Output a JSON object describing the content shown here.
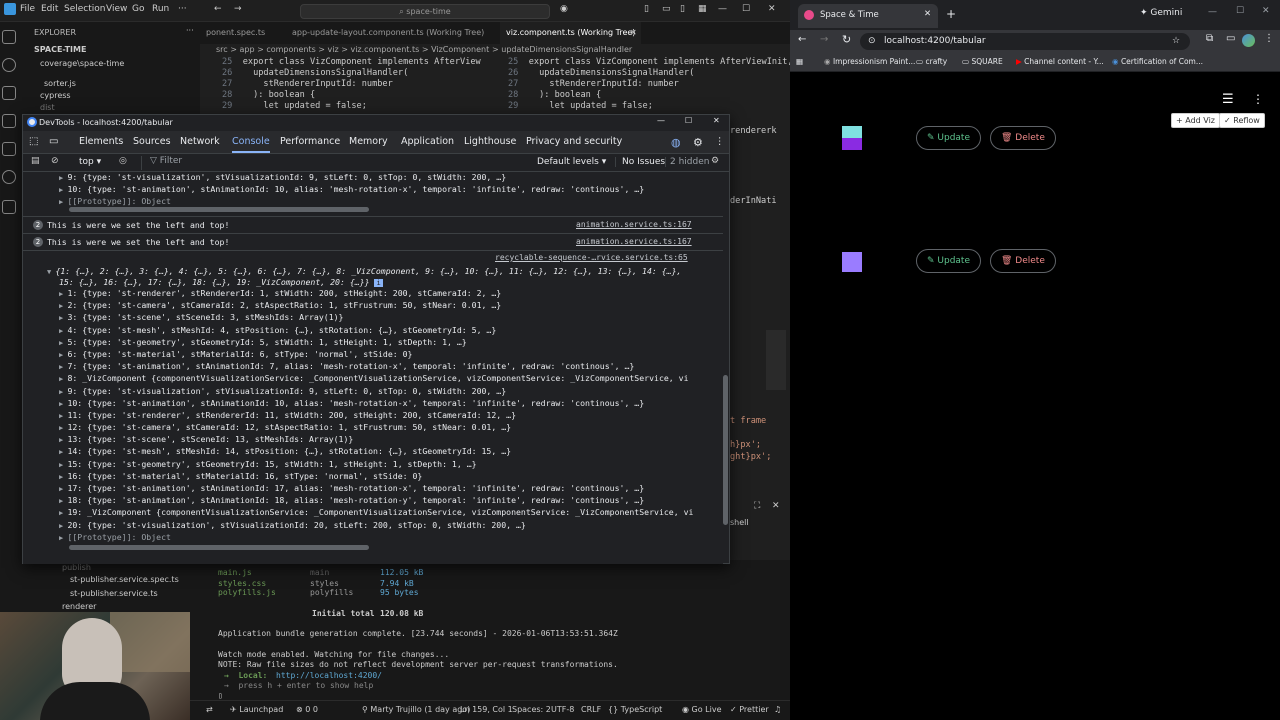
{
  "vscode": {
    "menu": [
      "File",
      "Edit",
      "Selection",
      "View",
      "Go",
      "Run"
    ],
    "search_placeholder": "space-time",
    "explorer": {
      "title": "EXPLORER",
      "project": "SPACE-TIME",
      "items": [
        "coverage\\space-time",
        "sorter.js",
        "cypress",
        "dist"
      ],
      "lower_items": [
        "publish",
        "st-publisher.service.spec.ts",
        "st-publisher.service.ts",
        "renderer"
      ]
    },
    "tabs": [
      {
        "label": "ponent.spec.ts",
        "active": false
      },
      {
        "label": "app-update-layout.component.ts (Working Tree)",
        "active": false
      },
      {
        "label": "viz.component.ts (Working Tree)",
        "active": true
      }
    ],
    "breadcrumb_left": "src > app > components > viz > viz.component.ts > VizComponent",
    "breadcrumb_right": "> updateDimensionsSignalHandler",
    "code_left": [
      {
        "n": "25",
        "text": "export class VizComponent implements AfterView"
      },
      {
        "n": "26",
        "text": "  updateDimensionsSignalHandler("
      },
      {
        "n": "27",
        "text": "    stRendererInputId: number"
      },
      {
        "n": "28",
        "text": "  ): boolean {"
      },
      {
        "n": "29",
        "text": "    let updated = false;"
      }
    ],
    "code_right": [
      {
        "n": "25",
        "text": "export class VizComponent implements AfterViewInit,"
      },
      {
        "n": "26",
        "text": "  updateDimensionsSignalHandler("
      },
      {
        "n": "27",
        "text": "    stRendererInputId: number"
      },
      {
        "n": "28",
        "text": "  ): boolean {"
      },
      {
        "n": "29",
        "text": "    let updated = false;"
      }
    ],
    "right_peek": [
      "rendererk",
      "derInNati",
      "t frame",
      "h}px';",
      "ght}px';"
    ],
    "terminal": {
      "rows": [
        {
          "file": "main.js",
          "name": "main",
          "size": "112.05 kB"
        },
        {
          "file": "styles.css",
          "name": "styles",
          "size": "7.94 kB"
        },
        {
          "file": "polyfills.js",
          "name": "polyfills",
          "size": "95 bytes"
        }
      ],
      "total_label": "Initial total",
      "total_size": "120.08 kB",
      "line1": "Application bundle generation complete. [23.744 seconds] - 2026-01-06T13:53:51.364Z",
      "line2": "Watch mode enabled. Watching for file changes...",
      "line3": "NOTE: Raw file sizes do not reflect development server per-request transformations.",
      "local_label": "→  Local:",
      "local_url": "http://localhost:4200/",
      "help": "→  press h + enter to show help",
      "shell": "shell"
    },
    "status": {
      "launchpad": "Launchpad",
      "problems": "0  0",
      "blame": "Marty Trujillo (1 day ago)",
      "position": "Ln 159, Col 1",
      "spaces": "Spaces: 2",
      "encoding": "UTF-8",
      "eol": "CRLF",
      "language": "TypeScript",
      "golive": "Go Live",
      "prettier": "Prettier"
    }
  },
  "devtools": {
    "title": "DevTools - localhost:4200/tabular",
    "tabs": [
      "Elements",
      "Sources",
      "Network",
      "Console",
      "Performance",
      "Memory",
      "Application",
      "Lighthouse",
      "Privacy and security"
    ],
    "active_tab": "Console",
    "context": "top",
    "filter_placeholder": "Filter",
    "levels": "Default levels",
    "issues": "No Issues",
    "hidden": "2 hidden",
    "prelines": [
      "9: {type: 'st-visualization', stVisualizationId: 9, stLeft: 0, stTop: 0, stWidth: 200, …}",
      "10: {type: 'st-animation', stAnimationId: 10, alias: 'mesh-rotation-x', temporal: 'infinite', redraw: 'continous', …}",
      "[[Prototype]]: Object"
    ],
    "messages": [
      {
        "count": "2",
        "text": "This is were we set the left and top!",
        "source": "animation.service.ts:167"
      },
      {
        "count": "2",
        "text": "This is were we set the left and top!",
        "source": "animation.service.ts:167"
      }
    ],
    "obj_source": "recyclable-sequence-…rvice.service.ts:65",
    "obj_summary_1": "{1: {…}, 2: {…}, 3: {…}, 4: {…}, 5: {…}, 6: {…}, 7: {…}, 8: _VizComponent, 9: {…}, 10: {…}, 11: {…}, 12: {…}, 13: {…}, 14: {…},",
    "obj_summary_2": "15: {…}, 16: {…}, 17: {…}, 18: {…}, 19: _VizComponent, 20: {…}}",
    "entries": [
      "1: {type: 'st-renderer', stRendererId: 1, stWidth: 200, stHeight: 200, stCameraId: 2, …}",
      "2: {type: 'st-camera', stCameraId: 2, stAspectRatio: 1, stFrustrum: 50, stNear: 0.01, …}",
      "3: {type: 'st-scene', stSceneId: 3, stMeshIds: Array(1)}",
      "4: {type: 'st-mesh', stMeshId: 4, stPosition: {…}, stRotation: {…}, stGeometryId: 5, …}",
      "5: {type: 'st-geometry', stGeometryId: 5, stWidth: 1, stHeight: 1, stDepth: 1, …}",
      "6: {type: 'st-material', stMaterialId: 6, stType: 'normal', stSide: 0}",
      "7: {type: 'st-animation', stAnimationId: 7, alias: 'mesh-rotation-x', temporal: 'infinite', redraw: 'continous', …}",
      "8: _VizComponent {componentVisualizationService: _ComponentVisualizationService, vizComponentService: _VizComponentService, vi",
      "9: {type: 'st-visualization', stVisualizationId: 9, stLeft: 0, stTop: 0, stWidth: 200, …}",
      "10: {type: 'st-animation', stAnimationId: 10, alias: 'mesh-rotation-x', temporal: 'infinite', redraw: 'continous', …}",
      "11: {type: 'st-renderer', stRendererId: 11, stWidth: 200, stHeight: 200, stCameraId: 12, …}",
      "12: {type: 'st-camera', stCameraId: 12, stAspectRatio: 1, stFrustrum: 50, stNear: 0.01, …}",
      "13: {type: 'st-scene', stSceneId: 13, stMeshIds: Array(1)}",
      "14: {type: 'st-mesh', stMeshId: 14, stPosition: {…}, stRotation: {…}, stGeometryId: 15, …}",
      "15: {type: 'st-geometry', stGeometryId: 15, stWidth: 1, stHeight: 1, stDepth: 1, …}",
      "16: {type: 'st-material', stMaterialId: 16, stType: 'normal', stSide: 0}",
      "17: {type: 'st-animation', stAnimationId: 17, alias: 'mesh-rotation-x', temporal: 'infinite', redraw: 'continous', …}",
      "18: {type: 'st-animation', stAnimationId: 18, alias: 'mesh-rotation-y', temporal: 'infinite', redraw: 'continous', …}",
      "19: _VizComponent {componentVisualizationService: _ComponentVisualizationService, vizComponentService: _VizComponentService, vi",
      "20: {type: 'st-visualization', stVisualizationId: 20, stLeft: 200, stTop: 0, stWidth: 200, …}"
    ],
    "prototype": "[[Prototype]]: Object"
  },
  "browser": {
    "tab_title": "Space & Time",
    "gemini": "Gemini",
    "url": "localhost:4200/tabular",
    "bookmarks": [
      "Impressionism Paint...",
      "crafty",
      "SQUARE",
      "Channel content - Y...",
      "Certification of Com..."
    ],
    "add_viz": "Add Viz",
    "reflow": "Reflow",
    "update_label": "Update",
    "delete_label": "Delete",
    "colors": {
      "cube1_top": "#7fe0e0",
      "cube1_bottom": "#8a2be2",
      "cube2": "#9a7cff",
      "update": "#5ec28d",
      "delete": "#f08a8a"
    }
  }
}
